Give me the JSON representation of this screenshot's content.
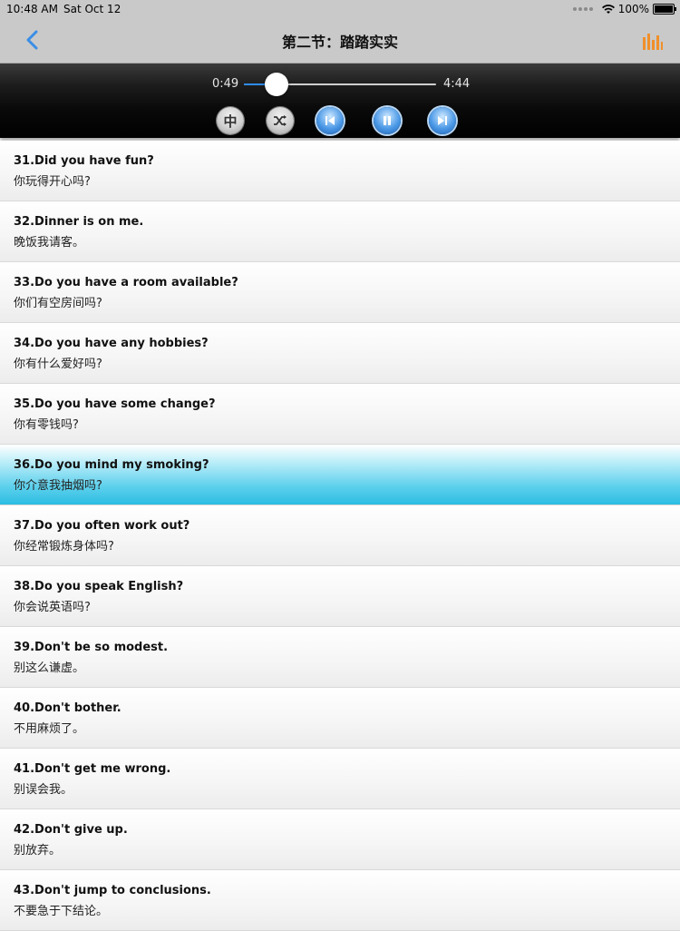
{
  "status_bar": {
    "time": "10:48 AM",
    "date": "Sat Oct 12",
    "battery": "100%"
  },
  "nav": {
    "title": "第二节：踏踏实实",
    "back_icon": "chevron-left-icon",
    "eq_icon": "equalizer-icon",
    "accent": "#3a8ee6",
    "eq_color": "#f0902a"
  },
  "player": {
    "elapsed": "0:49",
    "total": "4:44",
    "progress": 0.17,
    "language_button": "中",
    "shuffle_icon": "shuffle-icon",
    "prev_icon": "skip-previous-icon",
    "pause_icon": "pause-icon",
    "next_icon": "skip-next-icon"
  },
  "phrases": [
    {
      "en": "31.Did you have fun?",
      "cn": "你玩得开心吗?"
    },
    {
      "en": "32.Dinner is on me.",
      "cn": "晚饭我请客。"
    },
    {
      "en": "33.Do you have a room available?",
      "cn": "你们有空房间吗?"
    },
    {
      "en": "34.Do you have any hobbies?",
      "cn": "你有什么爱好吗?"
    },
    {
      "en": "35.Do you have some change?",
      "cn": "你有零钱吗?"
    },
    {
      "en": "36.Do you mind my smoking?",
      "cn": "你介意我抽烟吗?",
      "active": true
    },
    {
      "en": "37.Do you often work out?",
      "cn": "你经常锻炼身体吗?"
    },
    {
      "en": "38.Do you speak English?",
      "cn": "你会说英语吗?"
    },
    {
      "en": "39.Don't be so modest.",
      "cn": "别这么谦虚。"
    },
    {
      "en": "40.Don't bother.",
      "cn": "不用麻烦了。"
    },
    {
      "en": "41.Don't get me wrong.",
      "cn": "别误会我。"
    },
    {
      "en": "42.Don't give up.",
      "cn": "别放弃。"
    },
    {
      "en": "43.Don't jump to conclusions.",
      "cn": "不要急于下结论。"
    }
  ]
}
